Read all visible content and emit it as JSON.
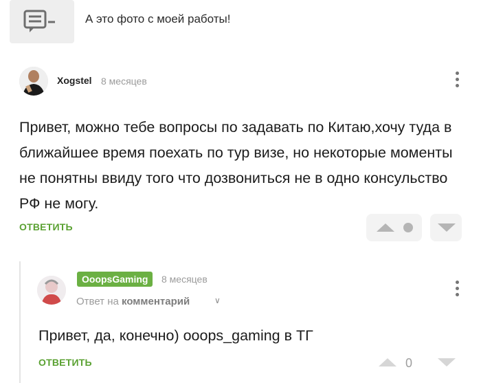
{
  "quoted": {
    "text": "А это фото с моей работы!",
    "icon": "comment-lines-icon"
  },
  "comment": {
    "username": "Xogstel",
    "time": "8 месяцев",
    "text": "Привет, можно тебе вопросы по задавать по Китаю,хочу туда в ближайшее время поехать по тур визе, но некоторые моменты не понятны ввиду того что дозвониться не в одно консульство РФ не могу.",
    "reply_label": "ОТВЕТИТЬ"
  },
  "reply": {
    "username": "OoopsGaming",
    "time": "8 месяцев",
    "reply_to_prefix": "Ответ на",
    "reply_to_target": "комментарий",
    "text": "Привет, да, конечно)  ooops_gaming в ТГ",
    "reply_label": "ОТВЕТИТЬ",
    "score": "0"
  },
  "colors": {
    "accent_green": "#5aa132",
    "badge_green": "#6bb043"
  }
}
